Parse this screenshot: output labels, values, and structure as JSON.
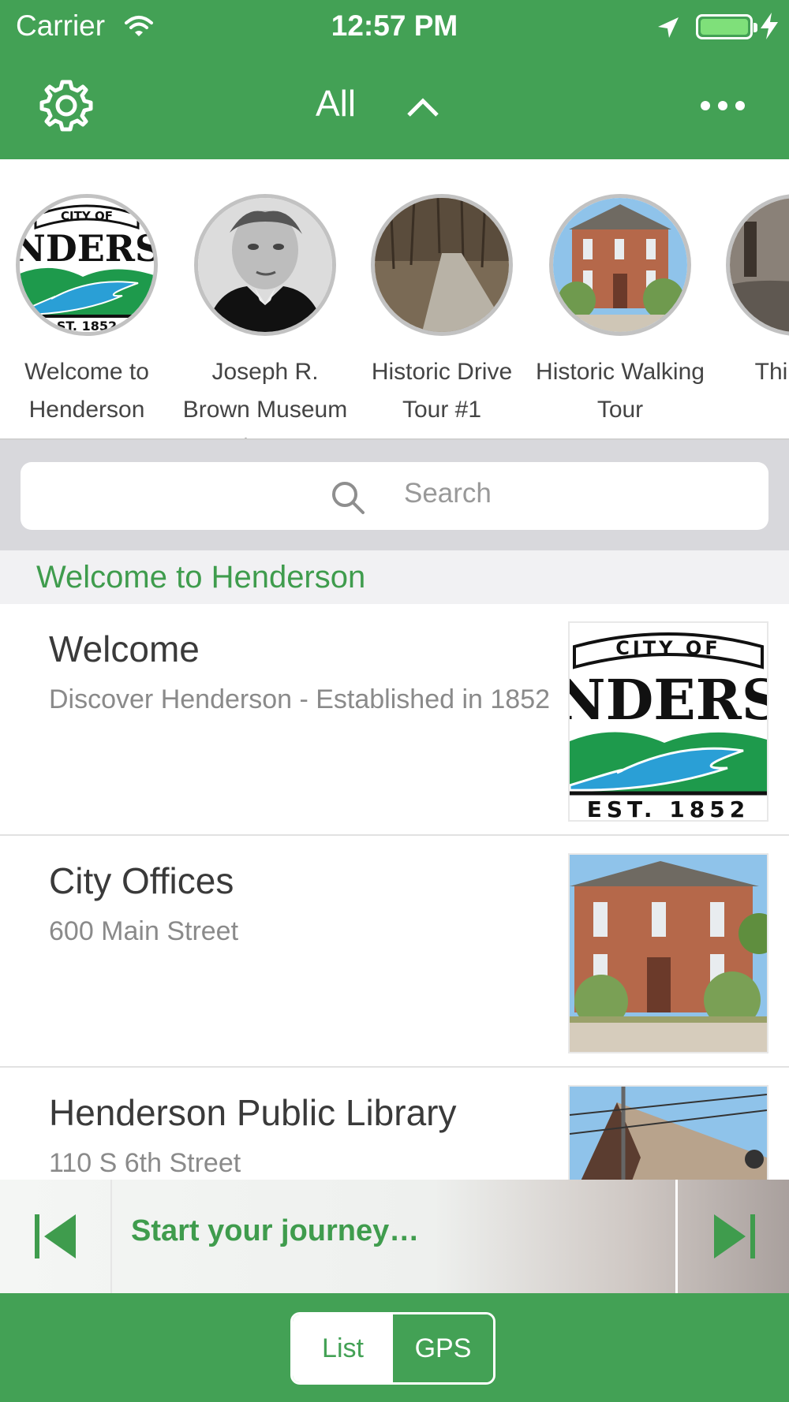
{
  "status_bar": {
    "carrier": "Carrier",
    "time": "12:57 PM"
  },
  "nav": {
    "title": "All",
    "icons": [
      "gear-icon",
      "chevron-up-icon",
      "more-icon"
    ]
  },
  "carousel": {
    "items": [
      {
        "label": "Welcome to Henderson",
        "image": "city-of-henderson-logo"
      },
      {
        "label": "Joseph R. Brown Museum / MN",
        "image": "portrait-photo"
      },
      {
        "label": "Historic Drive Tour #1",
        "image": "road-photo"
      },
      {
        "label": "Historic Walking Tour",
        "image": "brick-building-photo"
      },
      {
        "label": "Things t",
        "image": "river-photo"
      }
    ]
  },
  "search": {
    "placeholder": "Search"
  },
  "section": {
    "header": "Welcome to Henderson"
  },
  "list": [
    {
      "title": "Welcome",
      "subtitle": "Discover Henderson - Established in 1852",
      "image": "city-of-henderson-logo"
    },
    {
      "title": "City Offices",
      "subtitle": "600 Main Street",
      "image": "brick-building-photo"
    },
    {
      "title": "Henderson Public Library",
      "subtitle": "110 S 6th Street",
      "image": "library-roof-photo"
    }
  ],
  "logo_text": {
    "city_of": "CITY OF",
    "name": "NDERS",
    "est": "EST. 1852",
    "est_small": "ST. 1852"
  },
  "player": {
    "label": "Start your journey…"
  },
  "segmented": {
    "list": "List",
    "gps": "GPS",
    "selected": "List"
  },
  "colors": {
    "brand_green": "#43a155",
    "text_green": "#3f9c4d"
  }
}
